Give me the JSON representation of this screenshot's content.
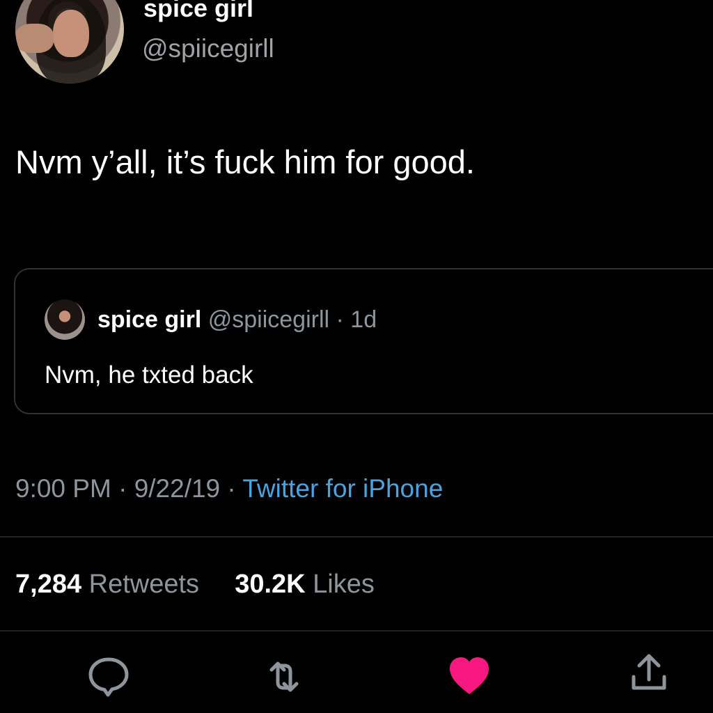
{
  "tweet": {
    "author_name": "spice girl",
    "author_handle": "@spiicegirll",
    "text": "Nvm y’all, it’s fuck him for good.",
    "time": "9:00 PM",
    "separator_1": " · ",
    "date": "9/22/19",
    "separator_2": " · ",
    "source": "Twitter for iPhone"
  },
  "quoted_tweet": {
    "author_name": "spice girl",
    "author_handle": "@spiicegirll",
    "separator": " · ",
    "age": "1d",
    "text": "Nvm, he txted back"
  },
  "stats": {
    "retweets_count": "7,284",
    "retweets_label": " Retweets",
    "likes_count": "30.2K",
    "likes_label": " Likes"
  },
  "actions": {
    "reply_icon": "reply-icon",
    "retweet_icon": "retweet-icon",
    "like_icon": "heart-icon",
    "share_icon": "share-icon",
    "like_color": "#f91880",
    "icon_color": "#8f959c"
  }
}
